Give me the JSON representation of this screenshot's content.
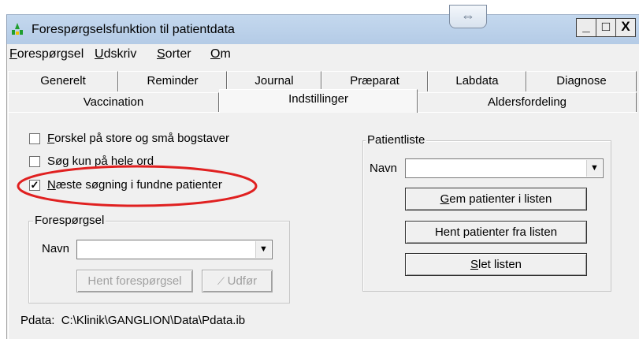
{
  "window": {
    "title": "Forespørgselsfunktion til patientdata",
    "resize_handle_glyph": "⇔",
    "controls": {
      "minimize": "_",
      "maximize": "□",
      "close": "X"
    }
  },
  "menu": [
    {
      "label": "Forespørgsel",
      "mnemonic": "F",
      "rest": "orespørgsel"
    },
    {
      "label": "Udskriv",
      "mnemonic": "U",
      "rest": "dskriv"
    },
    {
      "label": "Sorter",
      "mnemonic": "S",
      "rest": "orter"
    },
    {
      "label": "Om",
      "mnemonic": "O",
      "rest": "m"
    }
  ],
  "tabs": {
    "row1": [
      "Generelt",
      "Reminder",
      "Journal",
      "Præparat",
      "Labdata",
      "Diagnose"
    ],
    "row2": [
      "Vaccination",
      "Indstillinger",
      "Aldersfordeling"
    ],
    "active": "Indstillinger"
  },
  "options": [
    {
      "mnemonic": "F",
      "rest": "orskel på store og små bogstaver",
      "checked": false
    },
    {
      "mnemonic": "",
      "rest": "Søg kun på hele ord",
      "checked": false
    },
    {
      "mnemonic": "N",
      "rest": "æste søgning i fundne patienter",
      "checked": true
    }
  ],
  "query_group": {
    "title": "Forespørgsel",
    "name_label": "Navn",
    "name_value": "",
    "fetch_button": "Hent forespørgsel",
    "run_button": "Udfør",
    "run_icon": "pencil-icon"
  },
  "patient_group": {
    "title": "Patientliste",
    "name_label": "Navn",
    "name_value": "",
    "save_button": {
      "mnemonic": "G",
      "rest": "em patienter i listen"
    },
    "load_button": "Hent patienter fra listen",
    "delete_button": {
      "mnemonic": "S",
      "rest": "let listen"
    }
  },
  "status": {
    "label": "Pdata:",
    "path": "C:\\Klinik\\GANGLION\\Data\\Pdata.ib"
  },
  "colors": {
    "titlebar": "#b9cfe8",
    "annotation_ellipse": "#e02020",
    "app_icon_green": "#1f9e2e"
  }
}
